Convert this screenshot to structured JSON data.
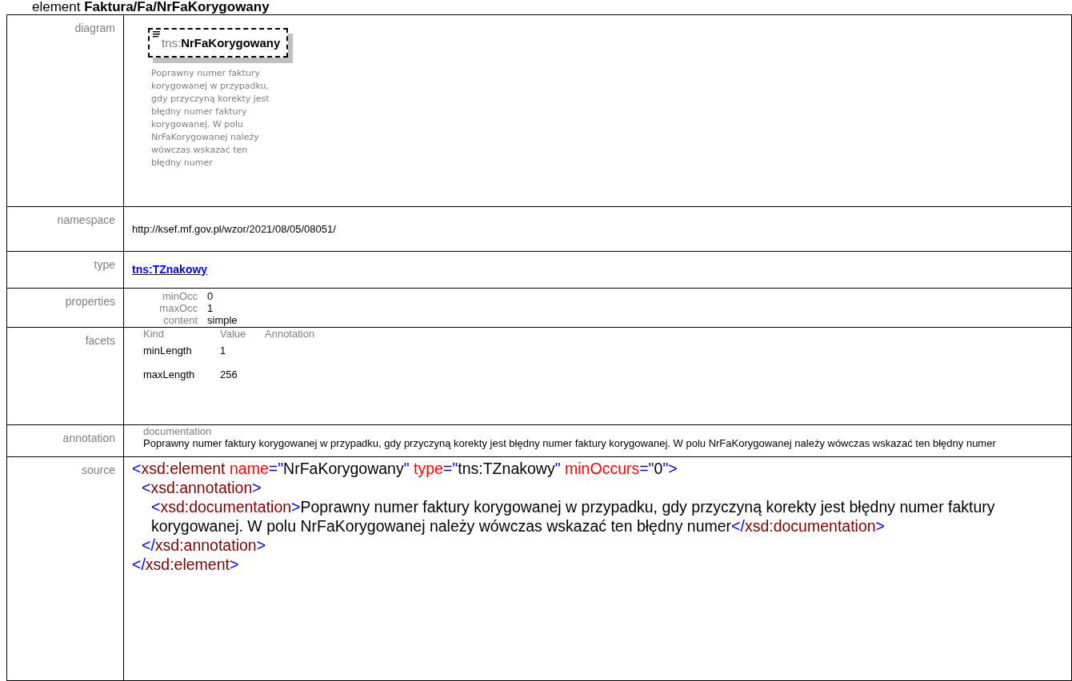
{
  "heading": "element **Faktura/Fa/NrFaKorygowany**",
  "diagram": {
    "label": "diagram",
    "prefix": "tns:",
    "name": "NrFaKorygowany",
    "description": "Poprawny numer faktury korygowanej w przypadku, gdy przyczyną korekty jest błędny numer faktury korygowanej. W polu NrFaKorygowanej należy wówczas wskazać ten błędny numer"
  },
  "namespace": {
    "label": "namespace",
    "value": "http://ksef.mf.gov.pl/wzor/2021/08/05/08051/"
  },
  "type": {
    "label": "type",
    "link": "tns:TZnakowy"
  },
  "properties": {
    "label": "properties",
    "items": [
      {
        "name": "minOcc",
        "value": "0"
      },
      {
        "name": "maxOcc",
        "value": "1"
      },
      {
        "name": "content",
        "value": "simple"
      }
    ]
  },
  "facets": {
    "label": "facets",
    "columns": [
      "Kind",
      "Value",
      "Annotation"
    ],
    "rows": [
      {
        "kind": "minLength",
        "value": "1"
      },
      {
        "kind": "maxLength",
        "value": "256"
      }
    ]
  },
  "annotation": {
    "label": "annotation",
    "title": "documentation",
    "text": "Poprawny numer faktury korygowanej w przypadku, gdy przyczyną korekty jest błędny numer faktury korygowanej. W polu NrFaKorygowanej należy wówczas wskazać ten błędny numer"
  },
  "source": {
    "label": "source",
    "lines": [
      {
        "kind": "outer",
        "tokens": [
          {
            "kind": "punct",
            "text": "<"
          },
          {
            "kind": "tag",
            "text": "xsd:element"
          },
          {
            "kind": "attr",
            "text": "name"
          },
          {
            "kind": "punct",
            "text": "=\""
          },
          {
            "kind": "value",
            "text": "NrFaKorygowany"
          },
          {
            "kind": "punct",
            "text": "\""
          },
          {
            "kind": "attr",
            "text": "type"
          },
          {
            "kind": "punct",
            "text": "=\""
          },
          {
            "kind": "value",
            "text": "tns:TZnakowy"
          },
          {
            "kind": "punct",
            "text": "\""
          },
          {
            "kind": "attr",
            "text": "minOccurs"
          },
          {
            "kind": "punct",
            "text": "=\""
          },
          {
            "kind": "value",
            "text": "0"
          },
          {
            "kind": "punct",
            "text": "\">"
          }
        ]
      },
      {
        "kind": "middle",
        "tokens": [
          {
            "kind": "punct",
            "text": "<"
          },
          {
            "kind": "tag",
            "text": "xsd:annotation"
          },
          {
            "kind": "punct",
            "text": ">"
          }
        ]
      },
      {
        "kind": "inner",
        "tokens": [
          {
            "kind": "punct",
            "text": "<"
          },
          {
            "kind": "tag",
            "text": "xsd:documentation"
          },
          {
            "kind": "punct",
            "text": ">"
          },
          {
            "kind": "value",
            "text": "Poprawny numer faktury korygowanej w przypadku, gdy przyczyną korekty jest błędny numer faktury korygowanej. W polu NrFaKorygowanej należy wówczas wskazać ten błędny numer"
          },
          {
            "kind": "punct",
            "text": "</"
          },
          {
            "kind": "tag",
            "text": "xsd:documentation"
          },
          {
            "kind": "punct",
            "text": ">"
          }
        ]
      },
      {
        "kind": "middle",
        "tokens": [
          {
            "kind": "punct",
            "text": "</"
          },
          {
            "kind": "tag",
            "text": "xsd:annotation"
          },
          {
            "kind": "punct",
            "text": ">"
          }
        ]
      },
      {
        "kind": "outer",
        "tokens": [
          {
            "kind": "punct",
            "text": "</"
          },
          {
            "kind": "tag",
            "text": "xsd:element"
          },
          {
            "kind": "punct",
            "text": ">"
          }
        ]
      }
    ]
  }
}
